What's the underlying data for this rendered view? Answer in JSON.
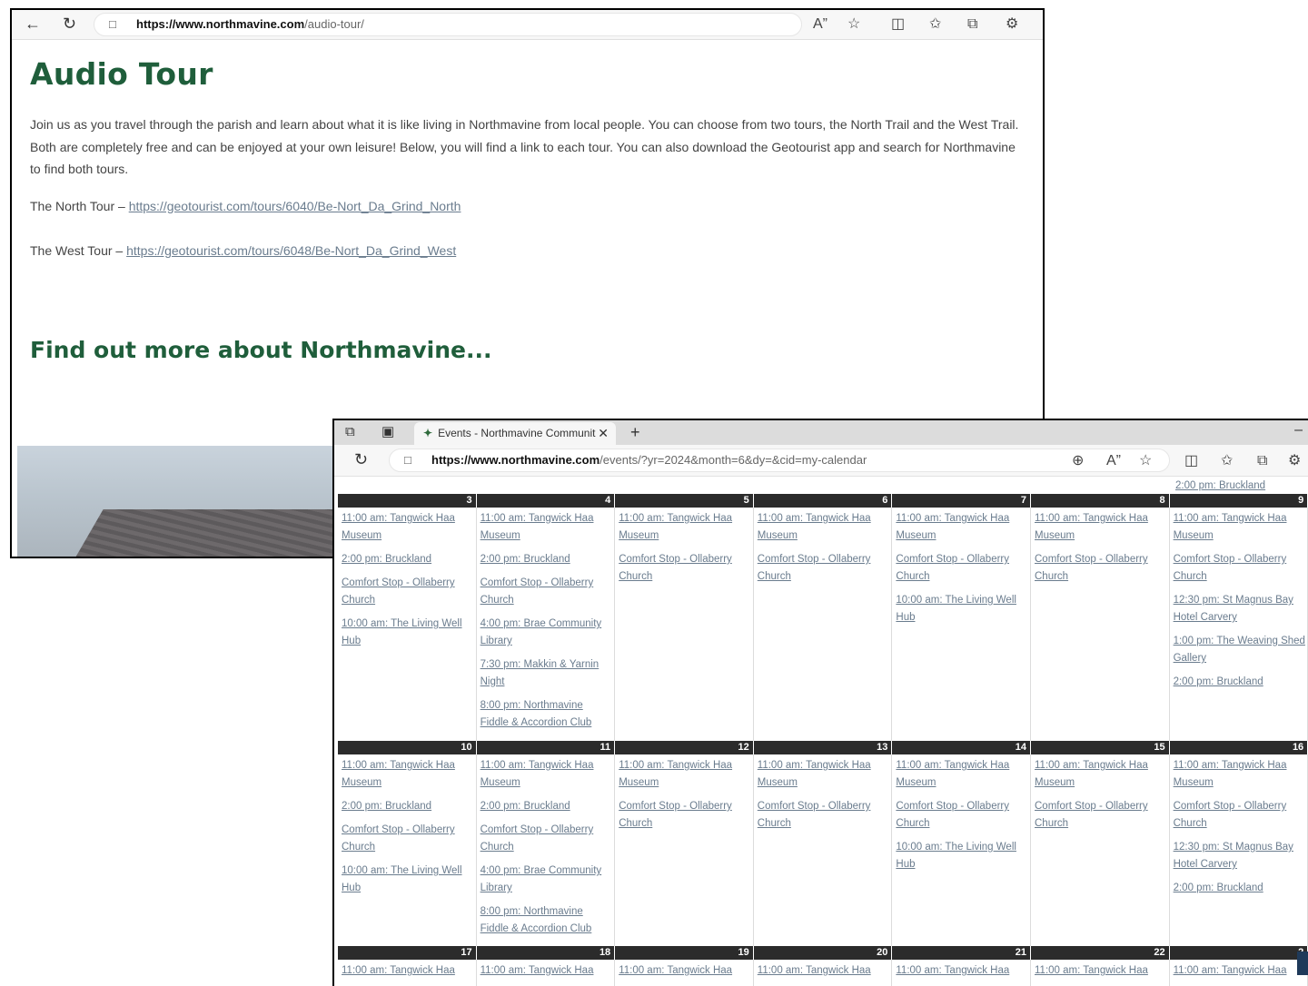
{
  "audio_window": {
    "url_host": "https://www.northmavine.com",
    "url_path": "/audio-tour/",
    "title": "Audio Tour",
    "intro": "Join us as you travel through the parish and learn about what it is like living in Northmavine from local people. You can choose from two tours, the North Trail and the West Trail. Both are completely free and can be enjoyed at your own leisure! Below, you will find a link to each tour. You can also download the Geotourist app and search for Northmavine to find both tours.",
    "north_label": "The North Tour – ",
    "north_link": "https://geotourist.com/tours/6040/Be-Nort_Da_Grind_North",
    "west_label": "The West Tour – ",
    "west_link": "https://geotourist.com/tours/6048/Be-Nort_Da_Grind_West",
    "more_heading": "Find out more about Northmavine...",
    "icons": [
      "back-icon",
      "refresh-icon",
      "lock-icon",
      "read-aloud-icon",
      "favorite-icon",
      "split-screen-icon",
      "favorites-icon",
      "collections-icon",
      "extensions-icon"
    ]
  },
  "events_window": {
    "tab_title": "Events - Northmavine Communit",
    "url_host": "https://www.northmavine.com",
    "url_path": "/events/?yr=2024&month=6&dy=&cid=my-calendar",
    "prev_week_event": "2:00 pm: Bruckland",
    "weeks": [
      {
        "days": [
          {
            "num": "3",
            "events": [
              "11:00 am: Tangwick Haa Museum",
              "2:00 pm: Bruckland",
              "Comfort Stop - Ollaberry Church",
              "10:00 am: The Living Well Hub"
            ]
          },
          {
            "num": "4",
            "events": [
              "11:00 am: Tangwick Haa Museum",
              "2:00 pm: Bruckland",
              "Comfort Stop - Ollaberry Church",
              "4:00 pm: Brae Community Library",
              "7:30 pm: Makkin & Yarnin Night",
              "8:00 pm: Northmavine Fiddle & Accordion Club"
            ]
          },
          {
            "num": "5",
            "events": [
              "11:00 am: Tangwick Haa Museum",
              "Comfort Stop - Ollaberry Church"
            ]
          },
          {
            "num": "6",
            "events": [
              "11:00 am: Tangwick Haa Museum",
              "Comfort Stop - Ollaberry Church"
            ]
          },
          {
            "num": "7",
            "events": [
              "11:00 am: Tangwick Haa Museum",
              "Comfort Stop - Ollaberry Church",
              "10:00 am: The Living Well Hub"
            ]
          },
          {
            "num": "8",
            "events": [
              "11:00 am: Tangwick Haa Museum",
              "Comfort Stop - Ollaberry Church"
            ]
          },
          {
            "num": "9",
            "events": [
              "11:00 am: Tangwick Haa Museum",
              "Comfort Stop - Ollaberry Church",
              "12:30 pm: St Magnus Bay Hotel Carvery",
              "1:00 pm: The Weaving Shed Gallery",
              "2:00 pm: Bruckland"
            ]
          }
        ]
      },
      {
        "days": [
          {
            "num": "10",
            "events": [
              "11:00 am: Tangwick Haa Museum",
              "2:00 pm: Bruckland",
              "Comfort Stop - Ollaberry Church",
              "10:00 am: The Living Well Hub"
            ]
          },
          {
            "num": "11",
            "events": [
              "11:00 am: Tangwick Haa Museum",
              "2:00 pm: Bruckland",
              "Comfort Stop - Ollaberry Church",
              "4:00 pm: Brae Community Library",
              "8:00 pm: Northmavine Fiddle & Accordion Club"
            ]
          },
          {
            "num": "12",
            "events": [
              "11:00 am: Tangwick Haa Museum",
              "Comfort Stop - Ollaberry Church"
            ]
          },
          {
            "num": "13",
            "events": [
              "11:00 am: Tangwick Haa Museum",
              "Comfort Stop - Ollaberry Church"
            ]
          },
          {
            "num": "14",
            "events": [
              "11:00 am: Tangwick Haa Museum",
              "Comfort Stop - Ollaberry Church",
              "10:00 am: The Living Well Hub"
            ]
          },
          {
            "num": "15",
            "events": [
              "11:00 am: Tangwick Haa Museum",
              "Comfort Stop - Ollaberry Church"
            ]
          },
          {
            "num": "16",
            "events": [
              "11:00 am: Tangwick Haa Museum",
              "Comfort Stop - Ollaberry Church",
              "12:30 pm: St Magnus Bay Hotel Carvery",
              "2:00 pm: Bruckland"
            ]
          }
        ]
      },
      {
        "days": [
          {
            "num": "17",
            "events": [
              "11:00 am: Tangwick Haa"
            ]
          },
          {
            "num": "18",
            "events": [
              "11:00 am: Tangwick Haa"
            ]
          },
          {
            "num": "19",
            "events": [
              "11:00 am: Tangwick Haa"
            ]
          },
          {
            "num": "20",
            "events": [
              "11:00 am: Tangwick Haa"
            ]
          },
          {
            "num": "21",
            "events": [
              "11:00 am: Tangwick Haa"
            ]
          },
          {
            "num": "22",
            "events": [
              "11:00 am: Tangwick Haa"
            ]
          },
          {
            "num": "2",
            "events": [
              "11:00 am: Tangwick Haa"
            ]
          }
        ]
      }
    ]
  },
  "colors": {
    "heading_green": "#1f5e3b",
    "link": "#6a7c8e",
    "day_header": "#2b2b2b"
  }
}
